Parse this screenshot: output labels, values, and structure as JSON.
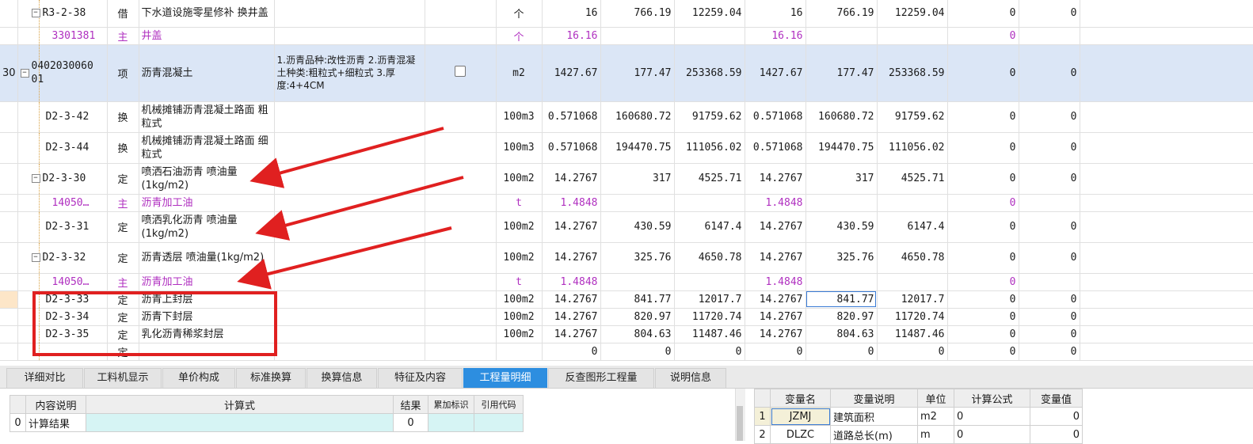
{
  "rows": [
    {
      "no": "",
      "code": "R3-2-38",
      "type": "借",
      "name": "下水道设施零星修补 换井盖",
      "feature": "",
      "check": false,
      "unit": "个",
      "qty": "16",
      "price": "766.19",
      "total": "12259.04",
      "qty2": "16",
      "price2": "766.19",
      "total2": "12259.04",
      "v1": "0",
      "v2": "0"
    },
    {
      "no": "",
      "code": "3301381",
      "type": "主",
      "name": "井盖",
      "feature": "",
      "unit": "个",
      "qty": "16.16",
      "price": "",
      "total": "",
      "qty2": "16.16",
      "price2": "",
      "total2": "",
      "v1": "0",
      "v2": ""
    },
    {
      "no": "30",
      "code": "040203006001",
      "type": "项",
      "name": "沥青混凝土",
      "feature": "1.沥青品种:改性沥青\n2.沥青混凝土种类:粗粒式+细粒式\n3.厚度:4+4CM",
      "check": true,
      "unit": "m2",
      "qty": "1427.67",
      "price": "177.47",
      "total": "253368.59",
      "qty2": "1427.67",
      "price2": "177.47",
      "total2": "253368.59",
      "v1": "0",
      "v2": "0"
    },
    {
      "no": "",
      "code": "D2-3-42",
      "type": "换",
      "name": "机械摊铺沥青混凝土路面 粗粒式",
      "feature": "",
      "unit": "100m3",
      "qty": "0.571068",
      "price": "160680.72",
      "total": "91759.62",
      "qty2": "0.571068",
      "price2": "160680.72",
      "total2": "91759.62",
      "v1": "0",
      "v2": "0"
    },
    {
      "no": "",
      "code": "D2-3-44",
      "type": "换",
      "name": "机械摊铺沥青混凝土路面 细粒式",
      "feature": "",
      "unit": "100m3",
      "qty": "0.571068",
      "price": "194470.75",
      "total": "111056.02",
      "qty2": "0.571068",
      "price2": "194470.75",
      "total2": "111056.02",
      "v1": "0",
      "v2": "0"
    },
    {
      "no": "",
      "code": "D2-3-30",
      "type": "定",
      "name": "喷洒石油沥青 喷油量(1kg/m2)",
      "feature": "",
      "unit": "100m2",
      "qty": "14.2767",
      "price": "317",
      "total": "4525.71",
      "qty2": "14.2767",
      "price2": "317",
      "total2": "4525.71",
      "v1": "0",
      "v2": "0"
    },
    {
      "no": "",
      "code": "14050…",
      "type": "主",
      "name": "沥青加工油",
      "feature": "",
      "unit": "t",
      "qty": "1.4848",
      "price": "",
      "total": "",
      "qty2": "1.4848",
      "price2": "",
      "total2": "",
      "v1": "0",
      "v2": ""
    },
    {
      "no": "",
      "code": "D2-3-31",
      "type": "定",
      "name": "喷洒乳化沥青 喷油量(1kg/m2)",
      "feature": "",
      "unit": "100m2",
      "qty": "14.2767",
      "price": "430.59",
      "total": "6147.4",
      "qty2": "14.2767",
      "price2": "430.59",
      "total2": "6147.4",
      "v1": "0",
      "v2": "0"
    },
    {
      "no": "",
      "code": "D2-3-32",
      "type": "定",
      "name": "沥青透层 喷油量(1kg/m2)",
      "feature": "",
      "unit": "100m2",
      "qty": "14.2767",
      "price": "325.76",
      "total": "4650.78",
      "qty2": "14.2767",
      "price2": "325.76",
      "total2": "4650.78",
      "v1": "0",
      "v2": "0"
    },
    {
      "no": "",
      "code": "14050…",
      "type": "主",
      "name": "沥青加工油",
      "feature": "",
      "unit": "t",
      "qty": "1.4848",
      "price": "",
      "total": "",
      "qty2": "1.4848",
      "price2": "",
      "total2": "",
      "v1": "0",
      "v2": ""
    },
    {
      "no": "",
      "code": "D2-3-33",
      "type": "定",
      "name": "沥青上封层",
      "feature": "",
      "unit": "100m2",
      "qty": "14.2767",
      "price": "841.77",
      "total": "12017.7",
      "qty2": "14.2767",
      "price2": "841.77",
      "total2": "12017.7",
      "v1": "0",
      "v2": "0"
    },
    {
      "no": "",
      "code": "D2-3-34",
      "type": "定",
      "name": "沥青下封层",
      "feature": "",
      "unit": "100m2",
      "qty": "14.2767",
      "price": "820.97",
      "total": "11720.74",
      "qty2": "14.2767",
      "price2": "820.97",
      "total2": "11720.74",
      "v1": "0",
      "v2": "0"
    },
    {
      "no": "",
      "code": "D2-3-35",
      "type": "定",
      "name": "乳化沥青稀浆封层",
      "feature": "",
      "unit": "100m2",
      "qty": "14.2767",
      "price": "804.63",
      "total": "11487.46",
      "qty2": "14.2767",
      "price2": "804.63",
      "total2": "11487.46",
      "v1": "0",
      "v2": "0"
    },
    {
      "no": "",
      "code": "",
      "type": "定",
      "name": "",
      "feature": "",
      "unit": "",
      "qty": "0",
      "price": "0",
      "total": "0",
      "qty2": "0",
      "price2": "0",
      "total2": "0",
      "v1": "0",
      "v2": "0"
    }
  ],
  "tabs": [
    "详细对比",
    "工料机显示",
    "单价构成",
    "标准换算",
    "换算信息",
    "特征及内容",
    "工程量明细",
    "反查图形工程量",
    "说明信息"
  ],
  "active_tab": "工程量明细",
  "calc": {
    "headers": [
      "内容说明",
      "计算式",
      "结果",
      "累加标识",
      "引用代码"
    ],
    "rows": [
      {
        "idx": "0",
        "desc": "计算结果",
        "expr": "",
        "result": "0"
      }
    ]
  },
  "vars": {
    "headers": [
      "变量名",
      "变量说明",
      "单位",
      "计算公式",
      "变量值"
    ],
    "rows": [
      {
        "idx": "1",
        "name": "JZMJ",
        "desc": "建筑面积",
        "unit": "m2",
        "formula": "0",
        "value": "0"
      },
      {
        "idx": "2",
        "name": "DLZC",
        "desc": "道路总长(m)",
        "unit": "m",
        "formula": "0",
        "value": "0"
      }
    ]
  },
  "colors": {
    "accent": "#2d8ee0",
    "sub": "#b030c0",
    "annotation": "#e02020",
    "selected_row": "#dbe6f6"
  }
}
